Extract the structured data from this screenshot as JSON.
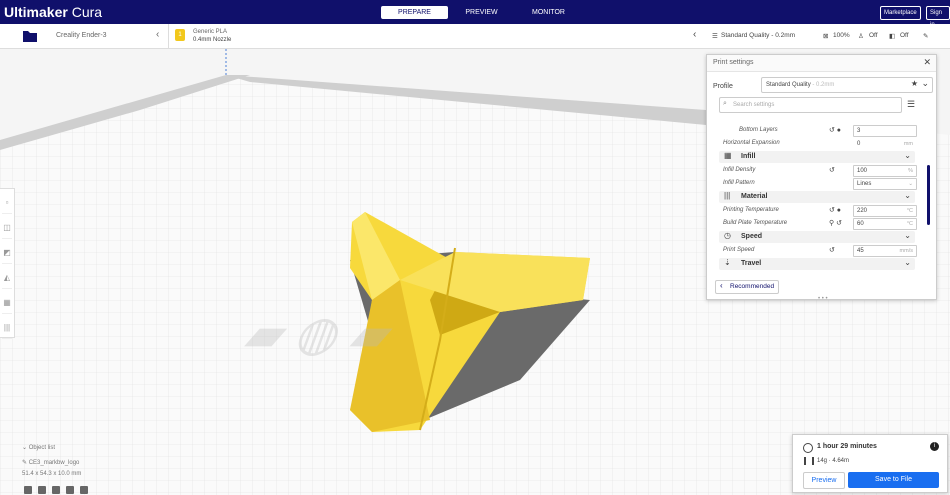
{
  "app": {
    "title_bold": "Ultimaker",
    "title_rest": " Cura"
  },
  "stages": [
    "PREPARE",
    "PREVIEW",
    "MONITOR"
  ],
  "top_buttons": {
    "marketplace": "Marketplace",
    "signin": "Sign in"
  },
  "printer": {
    "name": "Creality Ender-3"
  },
  "material": {
    "name": "Generic PLA",
    "nozzle": "0.4mm Nozzle"
  },
  "quality": {
    "profile": "Standard Quality - 0.2mm",
    "infill": "100%",
    "support": "Off",
    "adhesion": "Off"
  },
  "print_settings": {
    "title": "Print settings",
    "profile_label": "Profile",
    "profile_value": "Standard Quality",
    "profile_sub": "- 0.2mm",
    "search_placeholder": "Search settings",
    "rows": [
      {
        "kind": "setting",
        "label": "Bottom Layers",
        "value": "3",
        "unit": "",
        "icons": "↺ ●"
      },
      {
        "kind": "setting",
        "label": "Horizontal Expansion",
        "value": "0",
        "unit": "mm",
        "icons": ""
      },
      {
        "kind": "category",
        "label": "Infill",
        "icon": "▦"
      },
      {
        "kind": "setting",
        "label": "Infill Density",
        "value": "100",
        "unit": "%",
        "icons": "↺"
      },
      {
        "kind": "setting",
        "label": "Infill Pattern",
        "value": "Lines",
        "unit": "⌄",
        "icons": ""
      },
      {
        "kind": "category",
        "label": "Material",
        "icon": "|||"
      },
      {
        "kind": "setting",
        "label": "Printing Temperature",
        "value": "220",
        "unit": "°C",
        "icons": "↺ ●"
      },
      {
        "kind": "setting",
        "label": "Build Plate Temperature",
        "value": "60",
        "unit": "°C",
        "icons": "⚲ ↺"
      },
      {
        "kind": "category",
        "label": "Speed",
        "icon": "◷"
      },
      {
        "kind": "setting",
        "label": "Print Speed",
        "value": "45",
        "unit": "mm/s",
        "icons": "↺"
      },
      {
        "kind": "category",
        "label": "Travel",
        "icon": "⇣"
      }
    ],
    "recommended_label": "Recommended"
  },
  "print_estimate": {
    "time": "1 hour 29 minutes",
    "material": "14g · 4.64m",
    "preview_label": "Preview",
    "save_label": "Save to File"
  },
  "object_info": {
    "header": "Object list",
    "filename": "CE3_markbw_logo",
    "dimensions": "51.4 x 54.3 x 10.0 mm"
  },
  "colors": {
    "brand": "#10106b",
    "accent": "#196ef0",
    "model": "#f7d93c",
    "model_shade": "#cfa914"
  }
}
